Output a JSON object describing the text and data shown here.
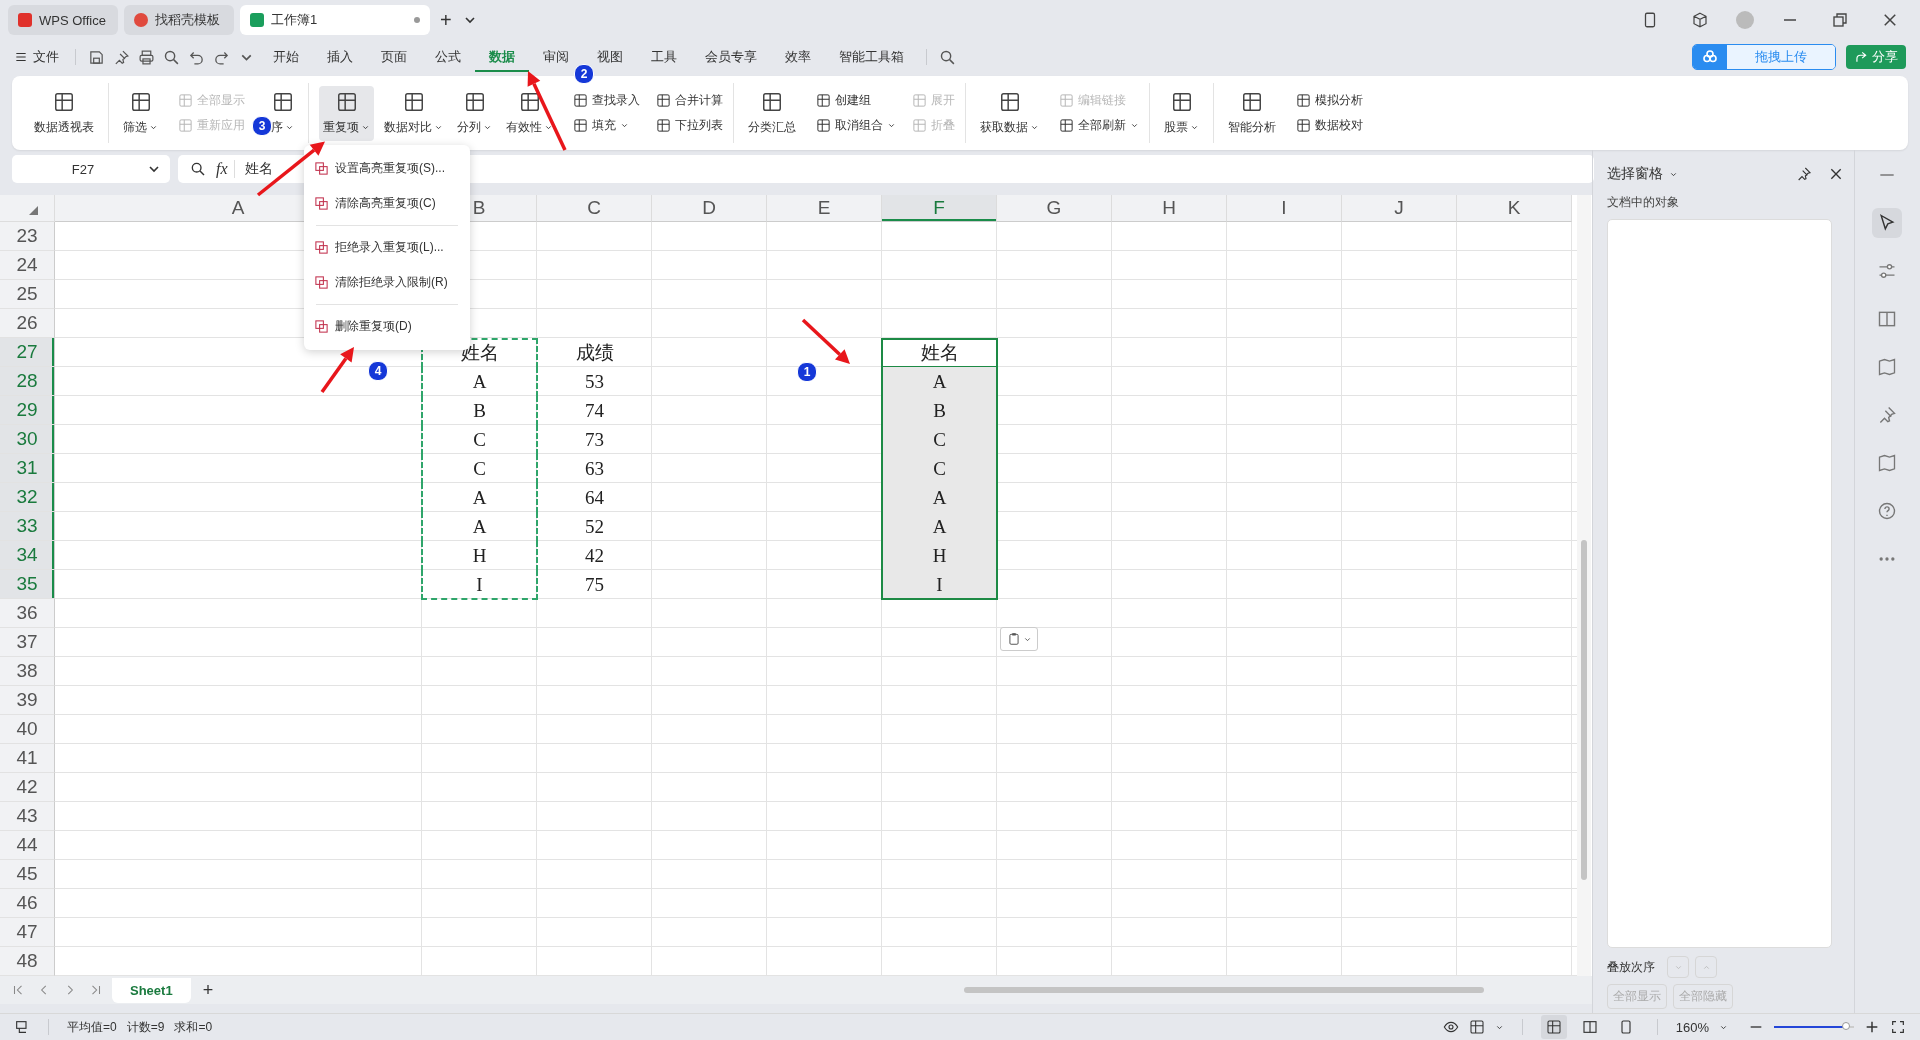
{
  "window_tabs": [
    {
      "kind": "home",
      "label": "WPS Office",
      "selected": false
    },
    {
      "kind": "template",
      "label": "找稻壳模板",
      "selected": false
    },
    {
      "kind": "sheet",
      "label": "工作簿1",
      "selected": true
    }
  ],
  "new_tab": "+",
  "menu_bar": {
    "file": "文件",
    "tabs": [
      {
        "label": "开始",
        "selected": false
      },
      {
        "label": "插入",
        "selected": false
      },
      {
        "label": "页面",
        "selected": false
      },
      {
        "label": "公式",
        "selected": false
      },
      {
        "label": "数据",
        "selected": true
      },
      {
        "label": "审阅",
        "selected": false
      },
      {
        "label": "视图",
        "selected": false
      },
      {
        "label": "工具",
        "selected": false
      },
      {
        "label": "会员专享",
        "selected": false
      },
      {
        "label": "效率",
        "selected": false
      },
      {
        "label": "智能工具箱",
        "selected": false
      }
    ],
    "upload_button": "拖拽上传",
    "share_button": "分享"
  },
  "ribbon": {
    "groups": [
      {
        "items": [
          {
            "kind": "big",
            "label": "数据透视表",
            "dropdown": false,
            "selected": false
          }
        ]
      },
      {
        "items": [
          {
            "kind": "big",
            "label": "筛选",
            "dropdown": true,
            "selected": false
          },
          {
            "kind": "stack",
            "buttons": [
              {
                "label": "全部显示",
                "disabled": true,
                "dropdown": false
              },
              {
                "label": "重新应用",
                "disabled": true,
                "dropdown": false
              }
            ]
          },
          {
            "kind": "big",
            "label": "序",
            "dropdown": true,
            "selected": false
          }
        ]
      },
      {
        "items": [
          {
            "kind": "big",
            "label": "重复项",
            "dropdown": true,
            "selected": true
          },
          {
            "kind": "big",
            "label": "数据对比",
            "dropdown": true,
            "selected": false
          },
          {
            "kind": "big",
            "label": "分列",
            "dropdown": true,
            "selected": false
          },
          {
            "kind": "big",
            "label": "有效性",
            "dropdown": true,
            "selected": false
          },
          {
            "kind": "stack",
            "buttons": [
              {
                "label": "查找录入",
                "disabled": false,
                "dropdown": false
              },
              {
                "label": "填充",
                "disabled": false,
                "dropdown": true
              }
            ]
          },
          {
            "kind": "stack",
            "buttons": [
              {
                "label": "合并计算",
                "disabled": false,
                "dropdown": false
              },
              {
                "label": "下拉列表",
                "disabled": false,
                "dropdown": false
              }
            ]
          }
        ]
      },
      {
        "items": [
          {
            "kind": "big",
            "label": "分类汇总",
            "dropdown": false,
            "selected": false
          },
          {
            "kind": "stack",
            "buttons": [
              {
                "label": "创建组",
                "disabled": false,
                "dropdown": false
              },
              {
                "label": "取消组合",
                "disabled": false,
                "dropdown": true
              }
            ]
          },
          {
            "kind": "stack",
            "buttons": [
              {
                "label": "展开",
                "disabled": true,
                "dropdown": false
              },
              {
                "label": "折叠",
                "disabled": true,
                "dropdown": false
              }
            ]
          }
        ]
      },
      {
        "items": [
          {
            "kind": "big",
            "label": "获取数据",
            "dropdown": true,
            "selected": false
          },
          {
            "kind": "stack",
            "buttons": [
              {
                "label": "编辑链接",
                "disabled": true,
                "dropdown": false
              },
              {
                "label": "全部刷新",
                "disabled": false,
                "dropdown": true
              }
            ]
          }
        ]
      },
      {
        "items": [
          {
            "kind": "big",
            "label": "股票",
            "dropdown": true,
            "selected": false
          }
        ]
      },
      {
        "items": [
          {
            "kind": "big",
            "label": "智能分析",
            "dropdown": false,
            "selected": false
          },
          {
            "kind": "stack",
            "buttons": [
              {
                "label": "模拟分析",
                "disabled": false,
                "dropdown": false
              },
              {
                "label": "数据校对",
                "disabled": false,
                "dropdown": false
              }
            ]
          }
        ]
      }
    ]
  },
  "formula_bar": {
    "name_box": "F27",
    "fx": "fx",
    "value": "姓名"
  },
  "dropdown_menu": [
    {
      "label": "设置高亮重复项(S)...",
      "divider_after": false
    },
    {
      "label": "清除高亮重复项(C)",
      "divider_after": true
    },
    {
      "label": "拒绝录入重复项(L)...",
      "divider_after": false
    },
    {
      "label": "清除拒绝录入限制(R)",
      "divider_after": true
    },
    {
      "label": "删除重复项(D)",
      "divider_after": false
    }
  ],
  "sheet": {
    "columns": [
      {
        "label": "A",
        "selected": false
      },
      {
        "label": "B",
        "selected": false
      },
      {
        "label": "C",
        "selected": false
      },
      {
        "label": "D",
        "selected": false
      },
      {
        "label": "E",
        "selected": false
      },
      {
        "label": "F",
        "selected": true
      },
      {
        "label": "G",
        "selected": false
      },
      {
        "label": "H",
        "selected": false
      },
      {
        "label": "I",
        "selected": false
      },
      {
        "label": "J",
        "selected": false
      },
      {
        "label": "K",
        "selected": false
      }
    ],
    "rows": [
      {
        "header": "23",
        "selected": false
      },
      {
        "header": "24",
        "selected": false
      },
      {
        "header": "25",
        "selected": false
      },
      {
        "header": "26",
        "selected": false
      },
      {
        "header": "27",
        "selected": true,
        "cells": {
          "B": {
            "text": "姓名",
            "copied": true,
            "selected": false,
            "active": false
          },
          "C": {
            "text": "成绩",
            "copied": false,
            "selected": false,
            "active": false
          },
          "F": {
            "text": "姓名",
            "copied": false,
            "selected": true,
            "active": true
          }
        }
      },
      {
        "header": "28",
        "selected": true,
        "cells": {
          "B": {
            "text": "A",
            "copied": true,
            "selected": false,
            "active": false
          },
          "C": {
            "text": "53",
            "copied": false,
            "selected": false,
            "active": false
          },
          "F": {
            "text": "A",
            "copied": false,
            "selected": true,
            "active": false
          }
        }
      },
      {
        "header": "29",
        "selected": true,
        "cells": {
          "B": {
            "text": "B",
            "copied": true,
            "selected": false,
            "active": false
          },
          "C": {
            "text": "74",
            "copied": false,
            "selected": false,
            "active": false
          },
          "F": {
            "text": "B",
            "copied": false,
            "selected": true,
            "active": false
          }
        }
      },
      {
        "header": "30",
        "selected": true,
        "cells": {
          "B": {
            "text": "C",
            "copied": true,
            "selected": false,
            "active": false
          },
          "C": {
            "text": "73",
            "copied": false,
            "selected": false,
            "active": false
          },
          "F": {
            "text": "C",
            "copied": false,
            "selected": true,
            "active": false
          }
        }
      },
      {
        "header": "31",
        "selected": true,
        "cells": {
          "B": {
            "text": "C",
            "copied": true,
            "selected": false,
            "active": false
          },
          "C": {
            "text": "63",
            "copied": false,
            "selected": false,
            "active": false
          },
          "F": {
            "text": "C",
            "copied": false,
            "selected": true,
            "active": false
          }
        }
      },
      {
        "header": "32",
        "selected": true,
        "cells": {
          "B": {
            "text": "A",
            "copied": true,
            "selected": false,
            "active": false
          },
          "C": {
            "text": "64",
            "copied": false,
            "selected": false,
            "active": false
          },
          "F": {
            "text": "A",
            "copied": false,
            "selected": true,
            "active": false
          }
        }
      },
      {
        "header": "33",
        "selected": true,
        "cells": {
          "B": {
            "text": "A",
            "copied": true,
            "selected": false,
            "active": false
          },
          "C": {
            "text": "52",
            "copied": false,
            "selected": false,
            "active": false
          },
          "F": {
            "text": "A",
            "copied": false,
            "selected": true,
            "active": false
          }
        }
      },
      {
        "header": "34",
        "selected": true,
        "cells": {
          "B": {
            "text": "H",
            "copied": true,
            "selected": false,
            "active": false
          },
          "C": {
            "text": "42",
            "copied": false,
            "selected": false,
            "active": false
          },
          "F": {
            "text": "H",
            "copied": false,
            "selected": true,
            "active": false
          }
        }
      },
      {
        "header": "35",
        "selected": true,
        "cells": {
          "B": {
            "text": "I",
            "copied": true,
            "selected": false,
            "active": false
          },
          "C": {
            "text": "75",
            "copied": false,
            "selected": false,
            "active": false
          },
          "F": {
            "text": "I",
            "copied": false,
            "selected": true,
            "active": false
          }
        }
      },
      {
        "header": "36",
        "selected": false
      },
      {
        "header": "37",
        "selected": false
      },
      {
        "header": "38",
        "selected": false
      },
      {
        "header": "39",
        "selected": false
      },
      {
        "header": "40",
        "selected": false
      },
      {
        "header": "41",
        "selected": false
      },
      {
        "header": "42",
        "selected": false
      },
      {
        "header": "43",
        "selected": false
      },
      {
        "header": "44",
        "selected": false
      },
      {
        "header": "45",
        "selected": false
      },
      {
        "header": "46",
        "selected": false
      },
      {
        "header": "47",
        "selected": false
      },
      {
        "header": "48",
        "selected": false
      }
    ]
  },
  "sheet_tabs": [
    {
      "label": "Sheet1",
      "selected": true
    }
  ],
  "add_sheet": "+",
  "selection_pane": {
    "title": "选择窗格",
    "subtitle": "文档中的对象",
    "order_label": "叠放次序",
    "buttons": [
      {
        "label": "全部显示",
        "disabled": true
      },
      {
        "label": "全部隐藏",
        "disabled": true
      }
    ]
  },
  "status_bar": {
    "stats": [
      "平均值=0",
      "计数=9",
      "求和=0"
    ],
    "zoom": "160%",
    "zoom_slider": {
      "level": 0.9
    }
  },
  "annotations": [
    {
      "number": "1"
    },
    {
      "number": "2"
    },
    {
      "number": "3"
    },
    {
      "number": "4"
    }
  ]
}
